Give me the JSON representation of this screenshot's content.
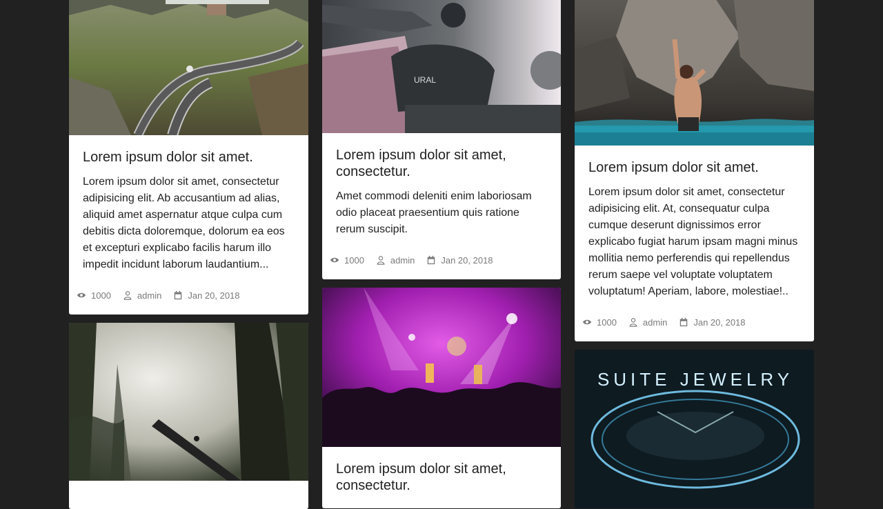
{
  "cards": [
    {
      "title": "Lorem ipsum dolor sit amet.",
      "text": "Lorem ipsum dolor sit amet, consectetur adipisicing elit. Ab accusantium ad alias, aliquid amet aspernatur atque culpa cum debitis dicta doloremque, dolorum ea eos et excepturi explicabo facilis harum illo impedit incidunt laborum laudantium...",
      "views": "1000",
      "author": "admin",
      "date": "Jan 20, 2018"
    },
    {
      "title": "Lorem ipsum dolor sit amet, consectetur.",
      "text": "Amet commodi deleniti enim laboriosam odio placeat praesentium quis ratione rerum suscipit.",
      "views": "1000",
      "author": "admin",
      "date": "Jan 20, 2018"
    },
    {
      "title": "Lorem ipsum dolor sit amet.",
      "text": "Lorem ipsum dolor sit amet, consectetur adipisicing elit. At, consequatur culpa cumque deserunt dignissimos error explicabo fugiat harum ipsam magni minus mollitia nemo perferendis qui repellendus rerum saepe vel voluptate voluptatem voluptatum! Aperiam, labore, molestiae!..",
      "views": "1000",
      "author": "admin",
      "date": "Jan 20, 2018"
    },
    {
      "title": "Lorem ipsum dolor sit amet, consectetur."
    }
  ],
  "photos": {
    "motorcycle_brand": "URAL",
    "neon_sign": "SUITE JEWELRY"
  },
  "icons": {
    "views": "eye-icon",
    "author": "user-icon",
    "date": "calendar-icon"
  }
}
